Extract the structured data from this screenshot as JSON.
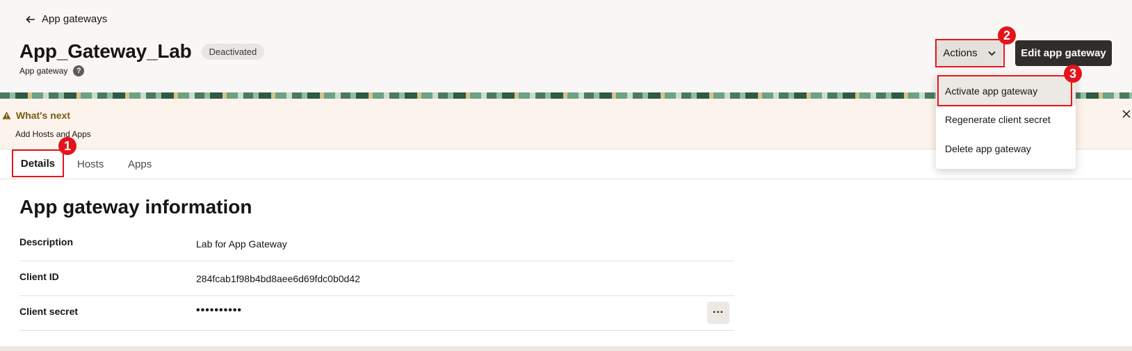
{
  "header": {
    "back_label": "App gateways",
    "title": "App_Gateway_Lab",
    "status": "Deactivated",
    "subtitle": "App gateway",
    "help_glyph": "?",
    "actions_label": "Actions",
    "edit_label": "Edit app gateway"
  },
  "notice": {
    "title": "What's next",
    "text": "Add Hosts and Apps"
  },
  "tabs": [
    {
      "label": "Details"
    },
    {
      "label": "Hosts"
    },
    {
      "label": "Apps"
    }
  ],
  "main": {
    "section_title": "App gateway information",
    "rows": [
      {
        "label": "Description",
        "value": "Lab for App Gateway"
      },
      {
        "label": "Client ID",
        "value": "284fcab1f98b4bd8aee6d69fdc0b0d42"
      },
      {
        "label": "Client secret",
        "value": "••••••••••"
      }
    ],
    "more_glyph": "···"
  },
  "actions_menu": {
    "items": [
      {
        "label": "Activate app gateway"
      },
      {
        "label": "Regenerate client secret"
      },
      {
        "label": "Delete app gateway"
      }
    ]
  },
  "callouts": [
    "1",
    "2",
    "3"
  ],
  "colors": {
    "accent_red": "#e5141b",
    "primary_button": "#312d2a",
    "notice_title": "#7a5a14"
  },
  "icons": [
    "back-arrow-icon",
    "help-icon",
    "chevron-down-icon",
    "warning-icon",
    "close-icon",
    "more-options-icon"
  ]
}
